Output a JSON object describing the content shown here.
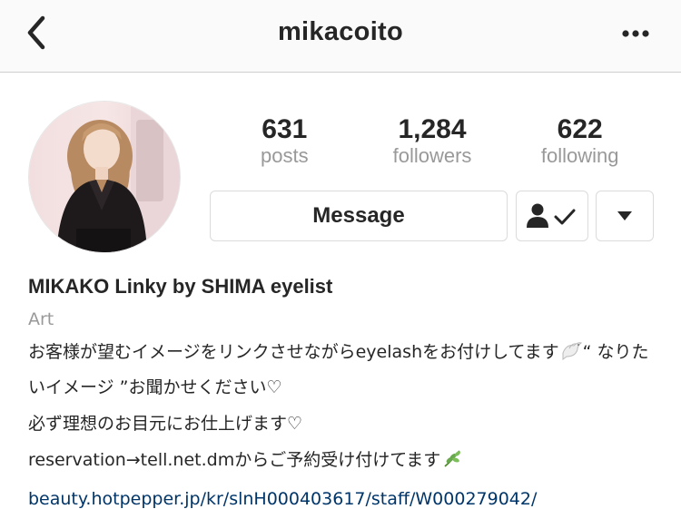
{
  "nav": {
    "title": "mikacoito",
    "back_icon": "chevron-left-icon",
    "more_icon": "more-horizontal-icon"
  },
  "profile": {
    "avatar_icon": "profile-photo",
    "stats": [
      {
        "count": "631",
        "label": "posts"
      },
      {
        "count": "1,284",
        "label": "followers"
      },
      {
        "count": "622",
        "label": "following"
      }
    ],
    "message_label": "Message",
    "following_icon": "person-check-icon",
    "dropdown_icon": "caret-down-icon"
  },
  "bio": {
    "name": "MIKAKO Linky by SHIMA eyelist",
    "category": "Art",
    "line1": "お客様が望むイメージをリンクさせながらeyelashをお付けしてます",
    "line1_tail": "“ なりた",
    "line2": "いイメージ ”お聞かせください♡",
    "line3": "必ず理想のお目元にお仕上げます♡",
    "line4": "reservation→tell.net.dmからご予約受け付けてます",
    "link": "beauty.hotpepper.jp/kr/slnH000403617/staff/W000279042/",
    "line1_icon": "dove-icon",
    "line4_icon": "herb-icon"
  },
  "colors": {
    "link": "#003569",
    "muted": "#999999",
    "border": "#dbdbdb",
    "text": "#262626"
  }
}
